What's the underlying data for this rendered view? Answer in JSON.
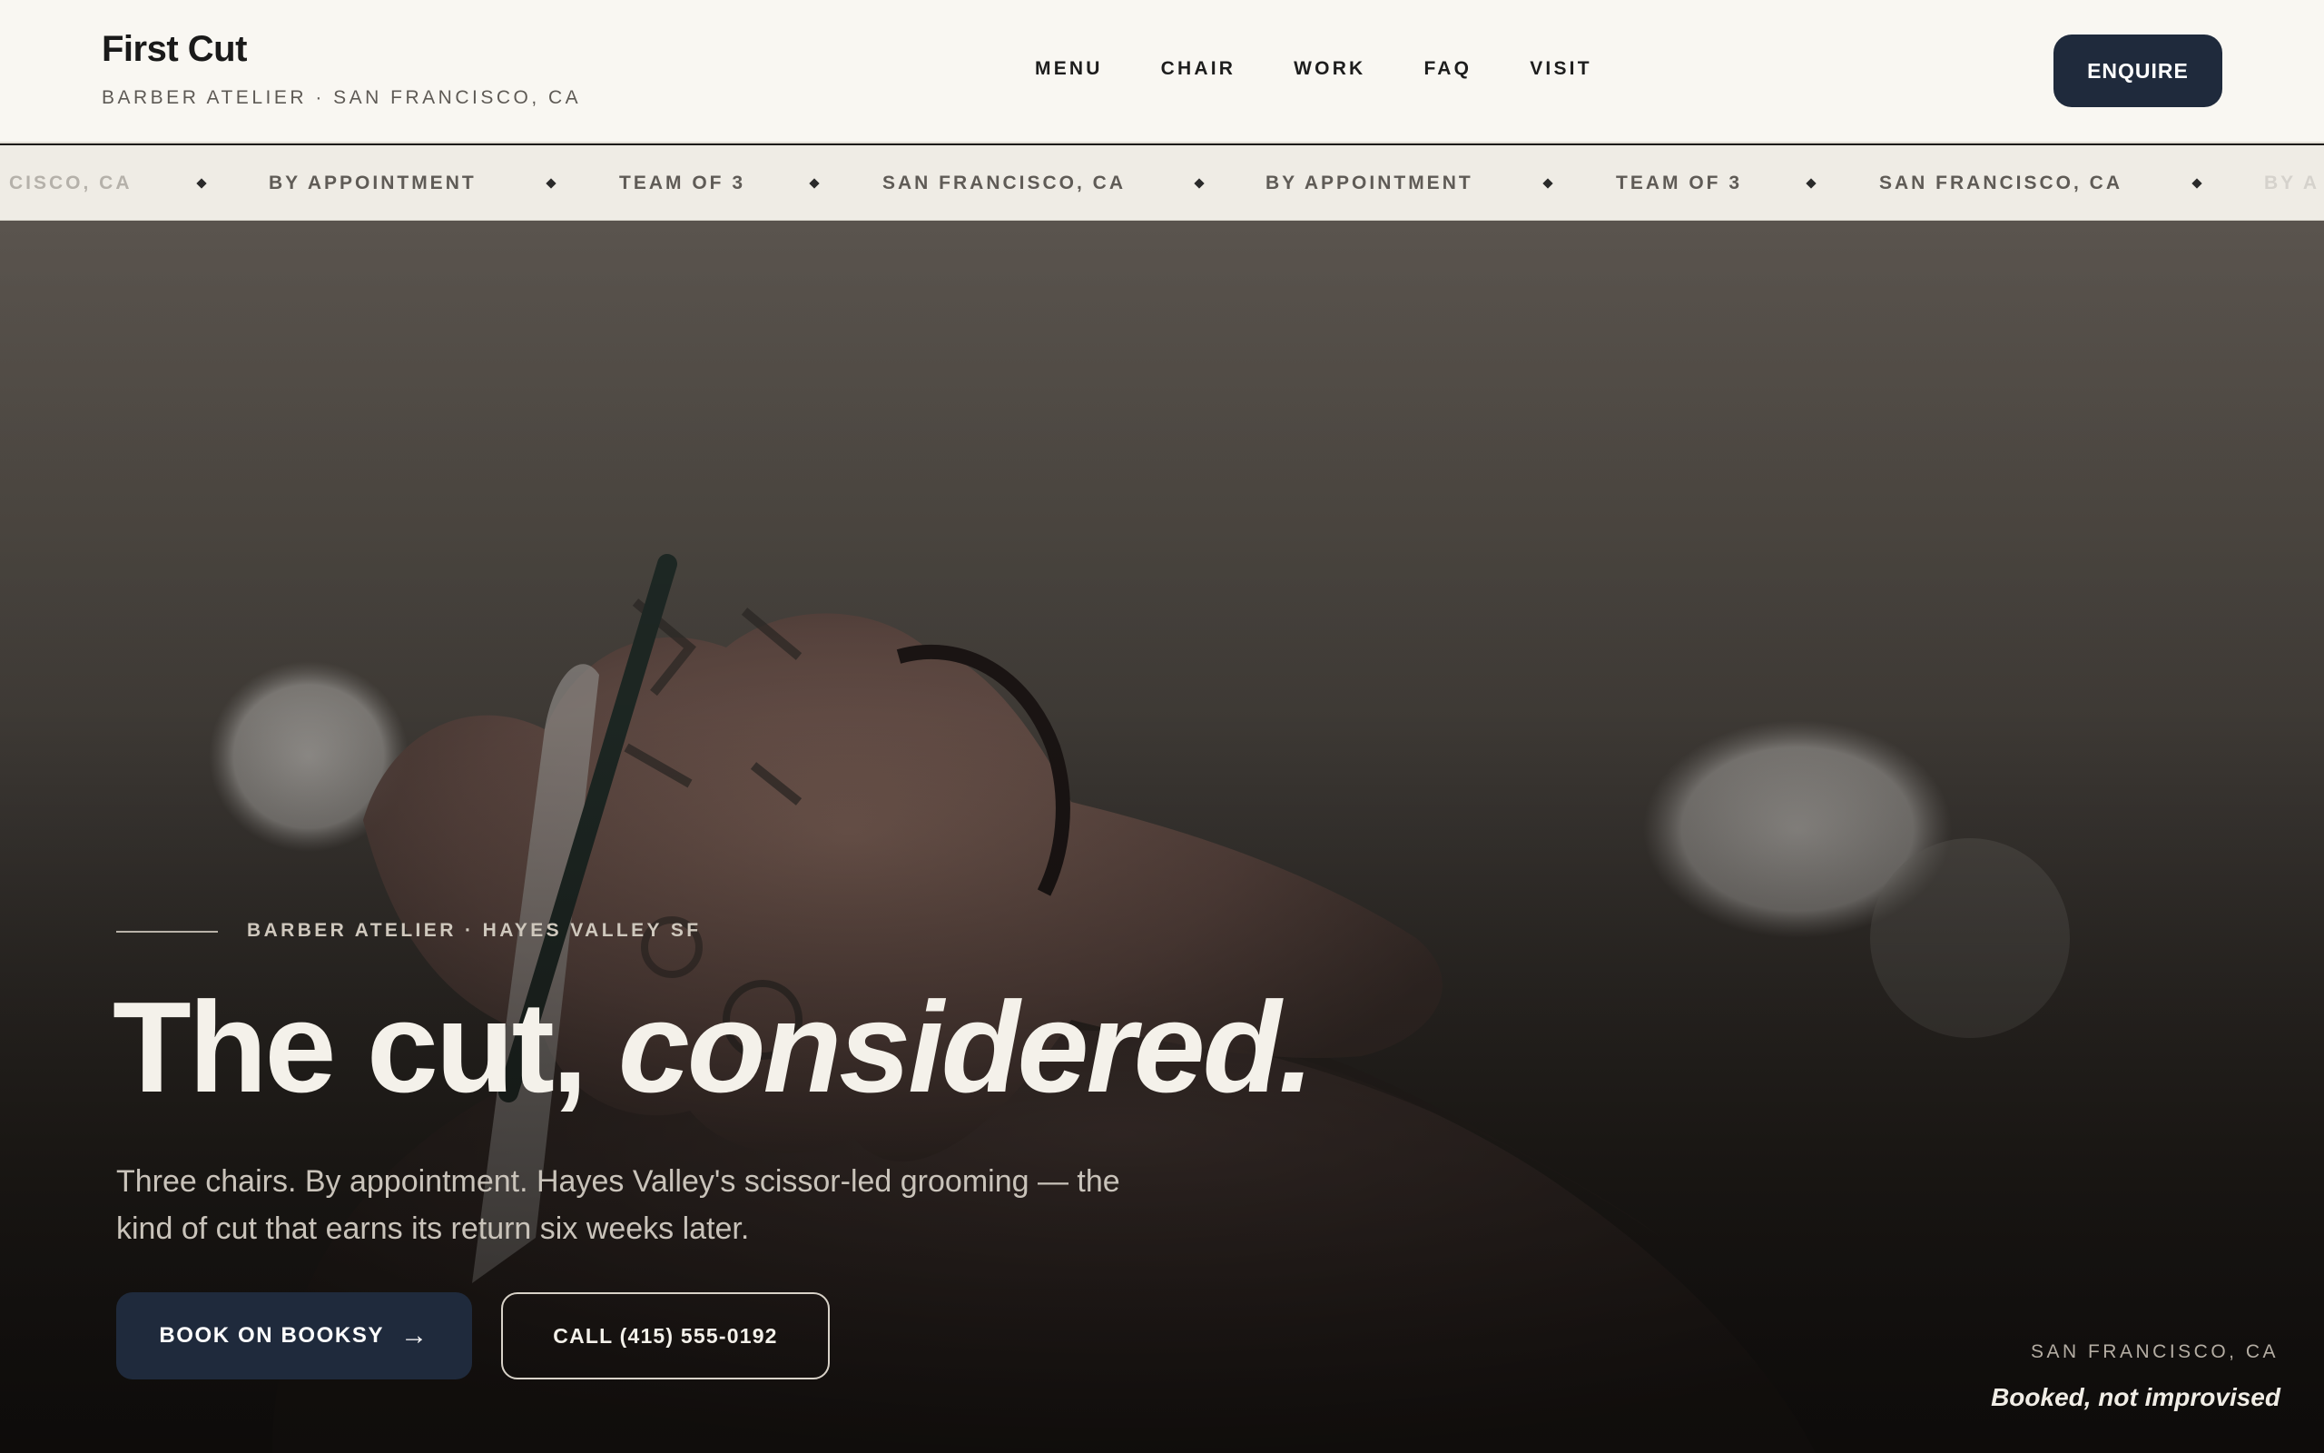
{
  "header": {
    "brand_name": "First Cut",
    "brand_tagline": "BARBER ATELIER · SAN FRANCISCO, CA",
    "nav": [
      "MENU",
      "CHAIR",
      "WORK",
      "FAQ",
      "VISIT"
    ],
    "cta_label": "ENQUIRE"
  },
  "ticker": {
    "items": [
      "CISCO, CA",
      "BY APPOINTMENT",
      "TEAM OF 3",
      "SAN FRANCISCO, CA",
      "BY APPOINTMENT",
      "TEAM OF 3",
      "SAN FRANCISCO, CA",
      "BY A"
    ]
  },
  "hero": {
    "eyebrow": "BARBER ATELIER · HAYES VALLEY SF",
    "headline_plain": "The cut, ",
    "headline_italic": "considered.",
    "lede": "Three chairs. By appointment. Hayes Valley's scissor-led grooming — the kind of cut that earns its return six weeks later.",
    "primary_button": "BOOK ON BOOKSY",
    "primary_arrow": "→",
    "secondary_button": "CALL (415) 555-0192",
    "location": "SAN FRANCISCO, CA",
    "booked_note": "Booked, not improvised"
  },
  "colors": {
    "accent_navy": "#1f2a3c",
    "header_bg": "#f9f7f2",
    "ticker_bg": "#efece5",
    "headline": "#f4f1ea"
  }
}
